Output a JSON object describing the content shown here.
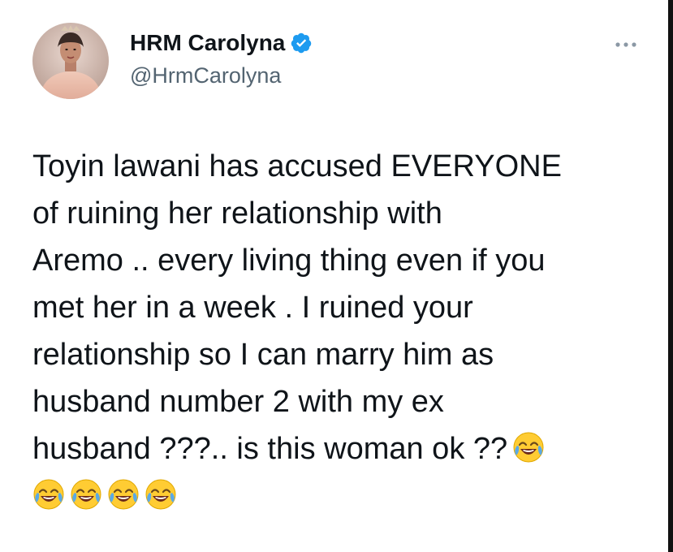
{
  "author": {
    "display_name": "HRM Carolyna",
    "handle": "@HrmCarolyna",
    "verified": true
  },
  "icons": {
    "verified": "verified-badge-icon",
    "more": "more-options-icon",
    "emoji": "face-with-tears-of-joy-emoji"
  },
  "colors": {
    "verified_blue": "#1d9bf0",
    "text": "#0f1419",
    "secondary_text": "#536471",
    "emoji_yellow": "#ffcc33",
    "emoji_tear": "#5aa9e6"
  },
  "tweet": {
    "lines": [
      "Toyin lawani has accused EVERYONE",
      "of ruining her relationship with",
      "Aremo .. every living thing even if you",
      "met her in a week . I ruined your",
      "relationship so I can marry him as",
      "husband number 2 with my ex",
      "husband ???.. is this woman ok ??"
    ],
    "emoji_count_after_last_line": 1,
    "emoji_count_next_line": 4
  }
}
